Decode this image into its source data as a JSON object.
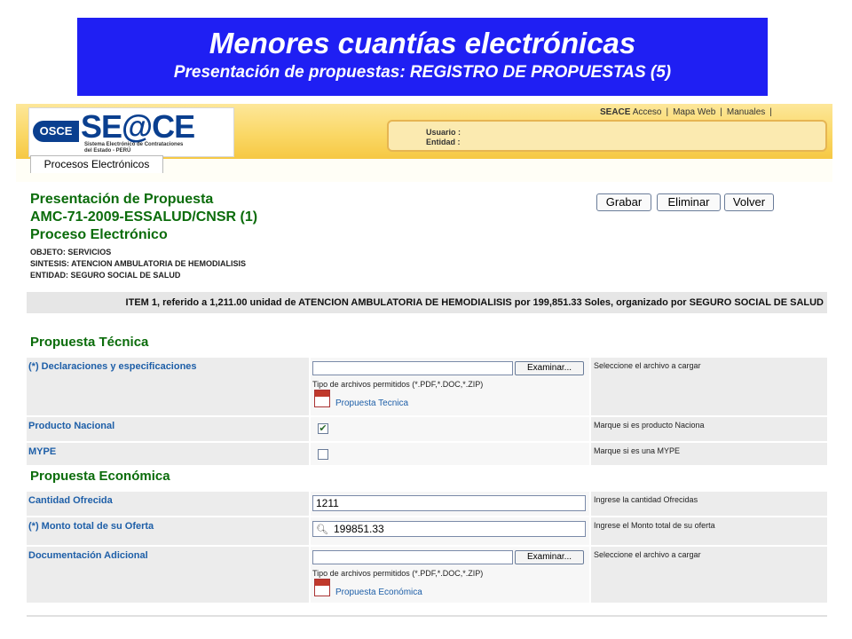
{
  "slide": {
    "title": "Menores cuantías electrónicas",
    "subtitle": "Presentación de propuestas: REGISTRO DE PROPUESTAS (5)"
  },
  "header": {
    "logo": {
      "osce": "OSCE",
      "brand": "SE@CE",
      "sub1": "Sistema Electrónico de Contrataciones",
      "sub2": "del Estado - PERÚ"
    },
    "links": {
      "seace": "SEACE",
      "acceso": "Acceso",
      "mapa": "Mapa Web",
      "manuales": "Manuales",
      "separator": "|"
    },
    "user_label": "Usuario :",
    "entity_label": "Entidad :",
    "tab": "Procesos Electrónicos"
  },
  "page": {
    "title1": "Presentación de Propuesta",
    "title2": "AMC-71-2009-ESSALUD/CNSR (1)",
    "title3": "Proceso Electrónico",
    "objeto": "OBJETO: SERVICIOS",
    "sintesis": "SINTESIS: ATENCION AMBULATORIA DE HEMODIALISIS",
    "entidad": "ENTIDAD: SEGURO SOCIAL DE SALUD",
    "buttons": {
      "grabar": "Grabar",
      "eliminar": "Eliminar",
      "volver": "Volver"
    },
    "item": "ITEM 1, referido a 1,211.00 unidad de ATENCION AMBULATORIA DE HEMODIALISIS  por 199,851.33 Soles, organizado por SEGURO SOCIAL DE SALUD"
  },
  "tecnica": {
    "section": "Propuesta Técnica",
    "declaraciones": {
      "label": "(*) Declaraciones y especificaciones",
      "button": "Examinar...",
      "types": "Tipo de archivos permitidos (*.PDF,*.DOC,*.ZIP)",
      "link": "Propuesta Tecnica",
      "help": "Seleccione el archivo a cargar"
    },
    "producto": {
      "label": "Producto Nacional",
      "checked": "✔",
      "help": "Marque si es producto Naciona"
    },
    "mype": {
      "label": "MYPE",
      "checked": "",
      "help": "Marque si es una MYPE"
    }
  },
  "economica": {
    "section": "Propuesta Económica",
    "cantidad": {
      "label": "Cantidad Ofrecida",
      "value": "1211",
      "help": "Ingrese la cantidad Ofrecidas"
    },
    "monto": {
      "label": "(*) Monto total de su Oferta",
      "value": "199851.33",
      "help": "Ingrese el Monto total de su oferta"
    },
    "documentacion": {
      "label": "Documentación Adicional",
      "button": "Examinar...",
      "types": "Tipo de archivos permitidos (*.PDF,*.DOC,*.ZIP)",
      "link": "Propuesta Económica",
      "help": "Seleccione el archivo a cargar"
    }
  }
}
